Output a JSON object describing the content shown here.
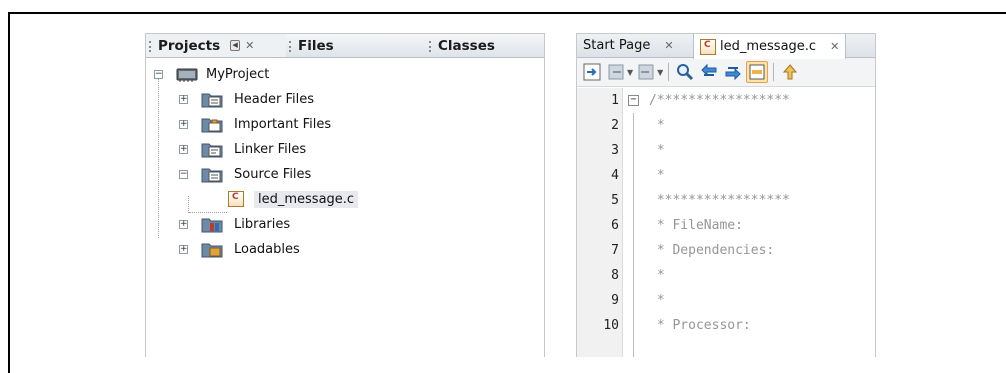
{
  "projects_panel": {
    "tabs": [
      {
        "label": "Projects"
      },
      {
        "label": "Files"
      },
      {
        "label": "Classes"
      }
    ],
    "tree": {
      "root": "MyProject",
      "items": [
        {
          "label": "Header Files",
          "icon": "header-folder-icon"
        },
        {
          "label": "Important Files",
          "icon": "important-folder-icon"
        },
        {
          "label": "Linker Files",
          "icon": "linker-folder-icon"
        },
        {
          "label": "Source Files",
          "icon": "source-folder-icon"
        },
        {
          "label": "led_message.c",
          "icon": "c-file-icon"
        },
        {
          "label": "Libraries",
          "icon": "libraries-folder-icon"
        },
        {
          "label": "Loadables",
          "icon": "loadables-folder-icon"
        }
      ]
    }
  },
  "editor": {
    "tabs": [
      {
        "label": "Start Page"
      },
      {
        "label": "led_message.c"
      }
    ],
    "lines": [
      {
        "num": "1",
        "text": "/*****************"
      },
      {
        "num": "2",
        "text": " *"
      },
      {
        "num": "3",
        "text": " *"
      },
      {
        "num": "4",
        "text": " *"
      },
      {
        "num": "5",
        "text": " *****************"
      },
      {
        "num": "6",
        "text": " * FileName:"
      },
      {
        "num": "7",
        "text": " * Dependencies:"
      },
      {
        "num": "8",
        "text": " *"
      },
      {
        "num": "9",
        "text": " *"
      },
      {
        "num": "10",
        "text": " * Processor:"
      }
    ]
  }
}
